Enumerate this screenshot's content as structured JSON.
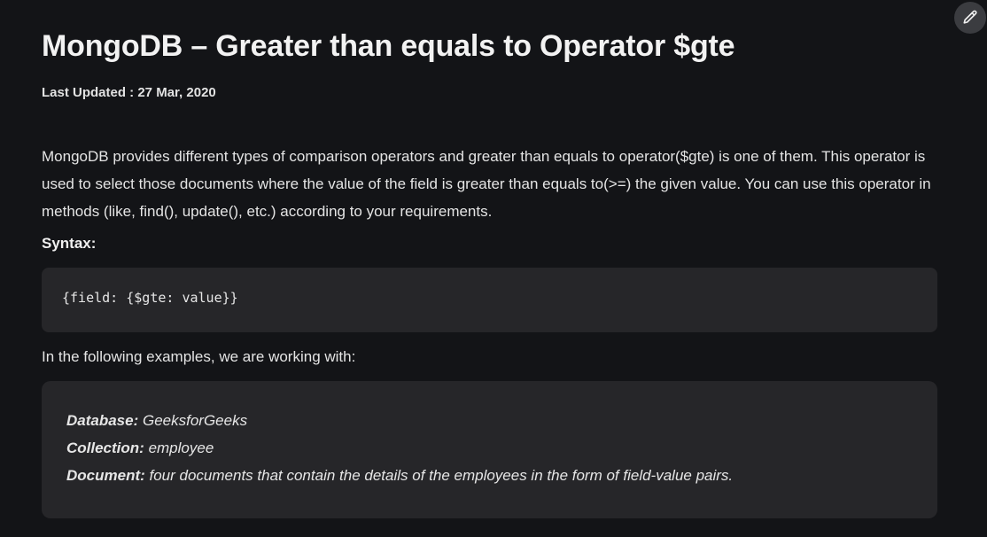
{
  "article": {
    "title": "MongoDB – Greater than equals to Operator $gte",
    "last_updated_label": "Last Updated : ",
    "last_updated_value": "27 Mar, 2020",
    "intro": "MongoDB provides different types of comparison operators and greater than equals to operator($gte) is one of them. This operator is used to select those documents where the value of the field is greater than equals to(>=) the given value. You can use this operator in methods (like, find(), update(), etc.) according to your requirements.",
    "syntax_label": "Syntax:",
    "syntax_code": "{field: {$gte: value}}",
    "following_text": "In the following examples, we are working with:",
    "info": {
      "database_label": "Database:",
      "database_value": " GeeksforGeeks",
      "collection_label": "Collection:",
      "collection_value": " employee",
      "document_label": "Document:",
      "document_value": " four documents that contain the details of the employees in the form of field-value pairs."
    }
  },
  "toolbar": {
    "edit_icon": "pencil-icon"
  },
  "colors": {
    "background": "#131417",
    "box": "#262629",
    "text": "#e6e6e6"
  }
}
